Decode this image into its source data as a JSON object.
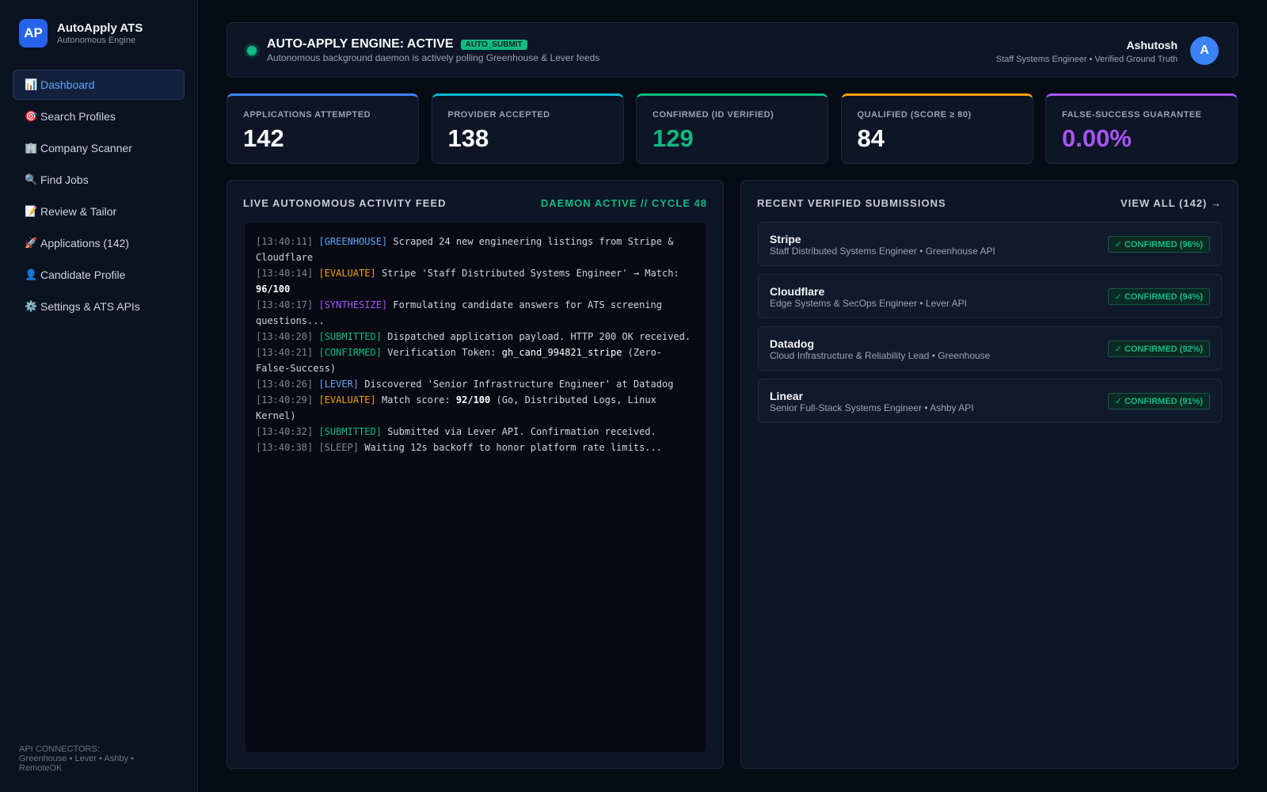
{
  "brand": {
    "logo": "AP",
    "name": "AutoApply ATS",
    "subtitle": "Autonomous Engine"
  },
  "sidebar": {
    "items": [
      {
        "icon": "📊",
        "icon_name": "chart-icon",
        "label": "Dashboard",
        "active": true
      },
      {
        "icon": "🎯",
        "icon_name": "target-icon",
        "label": "Search Profiles"
      },
      {
        "icon": "🏢",
        "icon_name": "office-building-icon",
        "label": "Company Scanner"
      },
      {
        "icon": "🔍",
        "icon_name": "magnifier-icon",
        "label": "Find Jobs"
      },
      {
        "icon": "📝",
        "icon_name": "memo-icon",
        "label": "Review & Tailor"
      },
      {
        "icon": "🚀",
        "icon_name": "rocket-icon",
        "label": "Applications (142)"
      },
      {
        "icon": "👤",
        "icon_name": "person-icon",
        "label": "Candidate Profile"
      },
      {
        "icon": "⚙️",
        "icon_name": "gear-icon",
        "label": "Settings & ATS APIs"
      }
    ],
    "footer": {
      "title": "API CONNECTORS:",
      "list": "Greenhouse • Lever • Ashby • RemoteOK"
    }
  },
  "header": {
    "title": "AUTO-APPLY ENGINE: ACTIVE",
    "badge": "AUTO_SUBMIT",
    "subtitle": "Autonomous background daemon is actively polling Greenhouse & Lever feeds",
    "user_name": "Ashutosh",
    "user_role": "Staff Systems Engineer • Verified Ground Truth",
    "avatar": "A"
  },
  "stats": [
    {
      "label": "APPLICATIONS ATTEMPTED",
      "value": "142",
      "accent": "#3b82f6",
      "value_color": "#f9fafb"
    },
    {
      "label": "PROVIDER ACCEPTED",
      "value": "138",
      "accent": "#06b6d4",
      "value_color": "#f9fafb"
    },
    {
      "label": "CONFIRMED (ID VERIFIED)",
      "value": "129",
      "accent": "#10b981",
      "value_color": "#10b981"
    },
    {
      "label": "QUALIFIED (SCORE ≥ 80)",
      "value": "84",
      "accent": "#f59e0b",
      "value_color": "#f9fafb"
    },
    {
      "label": "FALSE-SUCCESS GUARANTEE",
      "value": "0.00%",
      "accent": "#a855f7",
      "value_color": "#a855f7"
    }
  ],
  "feed": {
    "title": "LIVE AUTONOMOUS ACTIVITY FEED",
    "status": "DAEMON ACTIVE // CYCLE 48",
    "lines": [
      {
        "ts": "[13:40:11]",
        "tag": "[GREENHOUSE]",
        "tag_class": "tag-greenhouse",
        "text": "Scraped 24 new engineering listings from Stripe & Cloudflare"
      },
      {
        "ts": "[13:40:14]",
        "tag": "[EVALUATE]",
        "tag_class": "tag-evaluate",
        "text": "Stripe 'Staff Distributed Systems Engineer' → Match:",
        "hl": "96/100",
        "hl_class": "hl"
      },
      {
        "ts": "[13:40:17]",
        "tag": "[SYNTHESIZE]",
        "tag_class": "tag-synthesize",
        "text": "Formulating candidate answers for ATS screening questions..."
      },
      {
        "ts": "[13:40:20]",
        "tag": "[SUBMITTED]",
        "tag_class": "tag-submitted",
        "text": "Dispatched application payload. HTTP 200 OK received."
      },
      {
        "ts": "[13:40:21]",
        "tag": "[CONFIRMED]",
        "tag_class": "tag-confirmed",
        "text": "Verification Token:",
        "hl": "gh_cand_994821_stripe",
        "hl_class": "hl-plain",
        "after": "(Zero-False-Success)"
      },
      {
        "ts": "[13:40:26]",
        "tag": "[LEVER]",
        "tag_class": "tag-lever",
        "text": "Discovered 'Senior Infrastructure Engineer' at Datadog"
      },
      {
        "ts": "[13:40:29]",
        "tag": "[EVALUATE]",
        "tag_class": "tag-evaluate",
        "text": "Match score:",
        "hl": "92/100",
        "hl_class": "hl",
        "after": "(Go, Distributed Logs, Linux Kernel)"
      },
      {
        "ts": "[13:40:32]",
        "tag": "[SUBMITTED]",
        "tag_class": "tag-submitted",
        "text": "Submitted via Lever API. Confirmation received."
      },
      {
        "ts": "[13:40:38]",
        "tag": "[SLEEP]",
        "tag_class": "tag-sleep",
        "text": "Waiting 12s backoff to honor platform rate limits..."
      }
    ]
  },
  "submissions": {
    "title": "RECENT VERIFIED SUBMISSIONS",
    "view_all": "VIEW ALL (142) →",
    "items": [
      {
        "company": "Stripe",
        "detail": "Staff Distributed Systems Engineer • Greenhouse API",
        "status": "✓ CONFIRMED (96%)"
      },
      {
        "company": "Cloudflare",
        "detail": "Edge Systems & SecOps Engineer • Lever API",
        "status": "✓ CONFIRMED (94%)"
      },
      {
        "company": "Datadog",
        "detail": "Cloud Infrastructure & Reliability Lead • Greenhouse",
        "status": "✓ CONFIRMED (92%)"
      },
      {
        "company": "Linear",
        "detail": "Senior Full-Stack Systems Engineer • Ashby API",
        "status": "✓ CONFIRMED (91%)"
      }
    ]
  }
}
